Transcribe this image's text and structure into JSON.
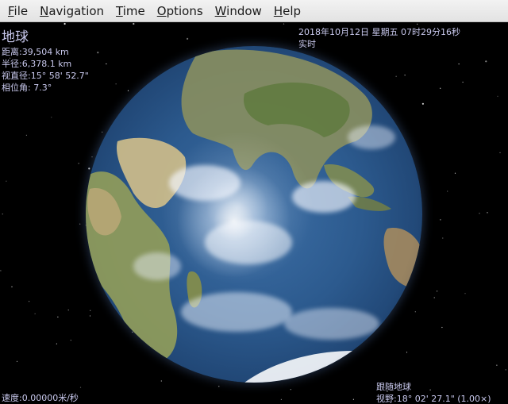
{
  "menu": {
    "items": [
      {
        "key": "file",
        "mnemonic": "F",
        "rest": "ile"
      },
      {
        "key": "navigation",
        "mnemonic": "N",
        "rest": "avigation"
      },
      {
        "key": "time",
        "mnemonic": "T",
        "rest": "ime"
      },
      {
        "key": "options",
        "mnemonic": "O",
        "rest": "ptions"
      },
      {
        "key": "window",
        "mnemonic": "W",
        "rest": "indow"
      },
      {
        "key": "help",
        "mnemonic": "H",
        "rest": "elp"
      }
    ]
  },
  "selection": {
    "name": "地球",
    "distance": "距离:39,504 km",
    "radius": "半径:6,378.1 km",
    "apparent_diameter": "视直径:15° 58' 52.7\"",
    "phase_angle": "相位角: 7.3°"
  },
  "time": {
    "datetime": "2018年10月12日 星期五 07时29分16秒",
    "mode": "实时"
  },
  "status": {
    "speed": "速度:0.00000米/秒",
    "tracking": "跟随地球",
    "fov": "视野:18° 02' 27.1\" (1.00×)"
  },
  "colors": {
    "hud_text": "#c9c9ee",
    "space": "#000000",
    "menubar": "#ececec"
  }
}
